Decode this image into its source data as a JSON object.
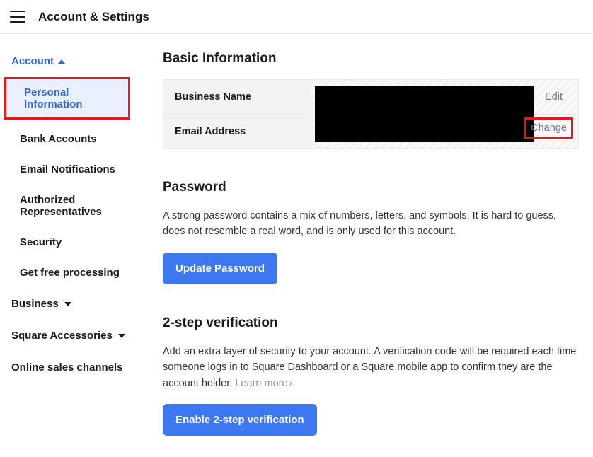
{
  "topbar": {
    "title": "Account & Settings"
  },
  "sidebar": {
    "account_group": "Account",
    "items": [
      "Personal Information",
      "Bank Accounts",
      "Email Notifications",
      "Authorized Representatives",
      "Security",
      "Get free processing"
    ],
    "business_group": "Business",
    "accessories_group": "Square Accessories",
    "online_channels": "Online sales channels"
  },
  "basic_info": {
    "heading": "Basic Information",
    "business_name_label": "Business Name",
    "email_label": "Email Address",
    "edit": "Edit",
    "change": "Change"
  },
  "password": {
    "heading": "Password",
    "desc": "A strong password contains a mix of numbers, letters, and symbols. It is hard to guess, does not resemble a real word, and is only used for this account.",
    "button": "Update Password"
  },
  "two_step": {
    "heading": "2-step verification",
    "desc": "Add an extra layer of security to your account. A verification code will be required each time someone logs in to Square Dashboard or a Square mobile app to confirm they are the account holder. ",
    "learn_more": "Learn more",
    "button": "Enable 2-step verification"
  }
}
